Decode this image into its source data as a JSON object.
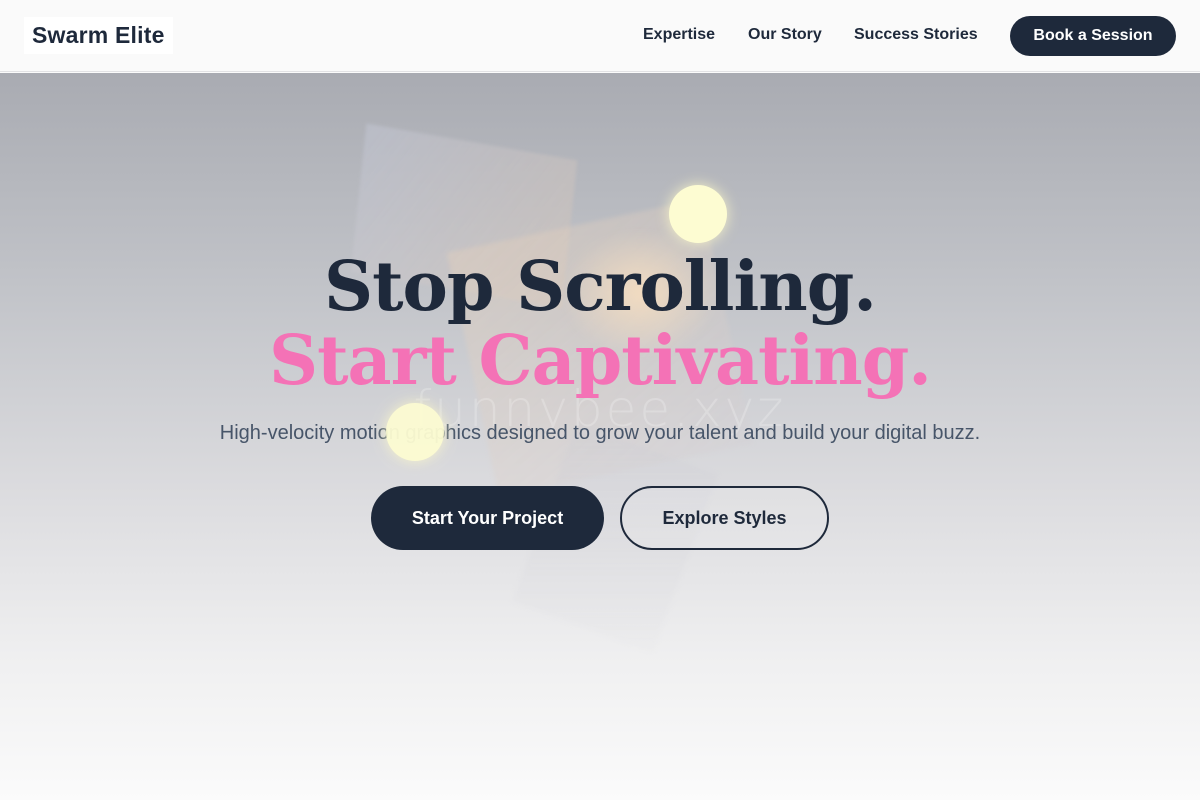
{
  "header": {
    "logo": "Swarm Elite",
    "nav": [
      {
        "label": "Expertise"
      },
      {
        "label": "Our Story"
      },
      {
        "label": "Success Stories"
      }
    ],
    "cta_label": "Book a Session"
  },
  "hero": {
    "headline_line1": "Stop Scrolling.",
    "headline_line2": "Start Captivating.",
    "watermark": "funnybee.xyz",
    "subtitle": "High-velocity motion graphics designed to grow your talent and build your digital buzz.",
    "primary_button": "Start Your Project",
    "secondary_button": "Explore Styles"
  },
  "colors": {
    "navy": "#1e293b",
    "accent_pink": "#f472b6",
    "subtitle_slate": "#475569",
    "orb_yellow": "#fdfcd2"
  }
}
